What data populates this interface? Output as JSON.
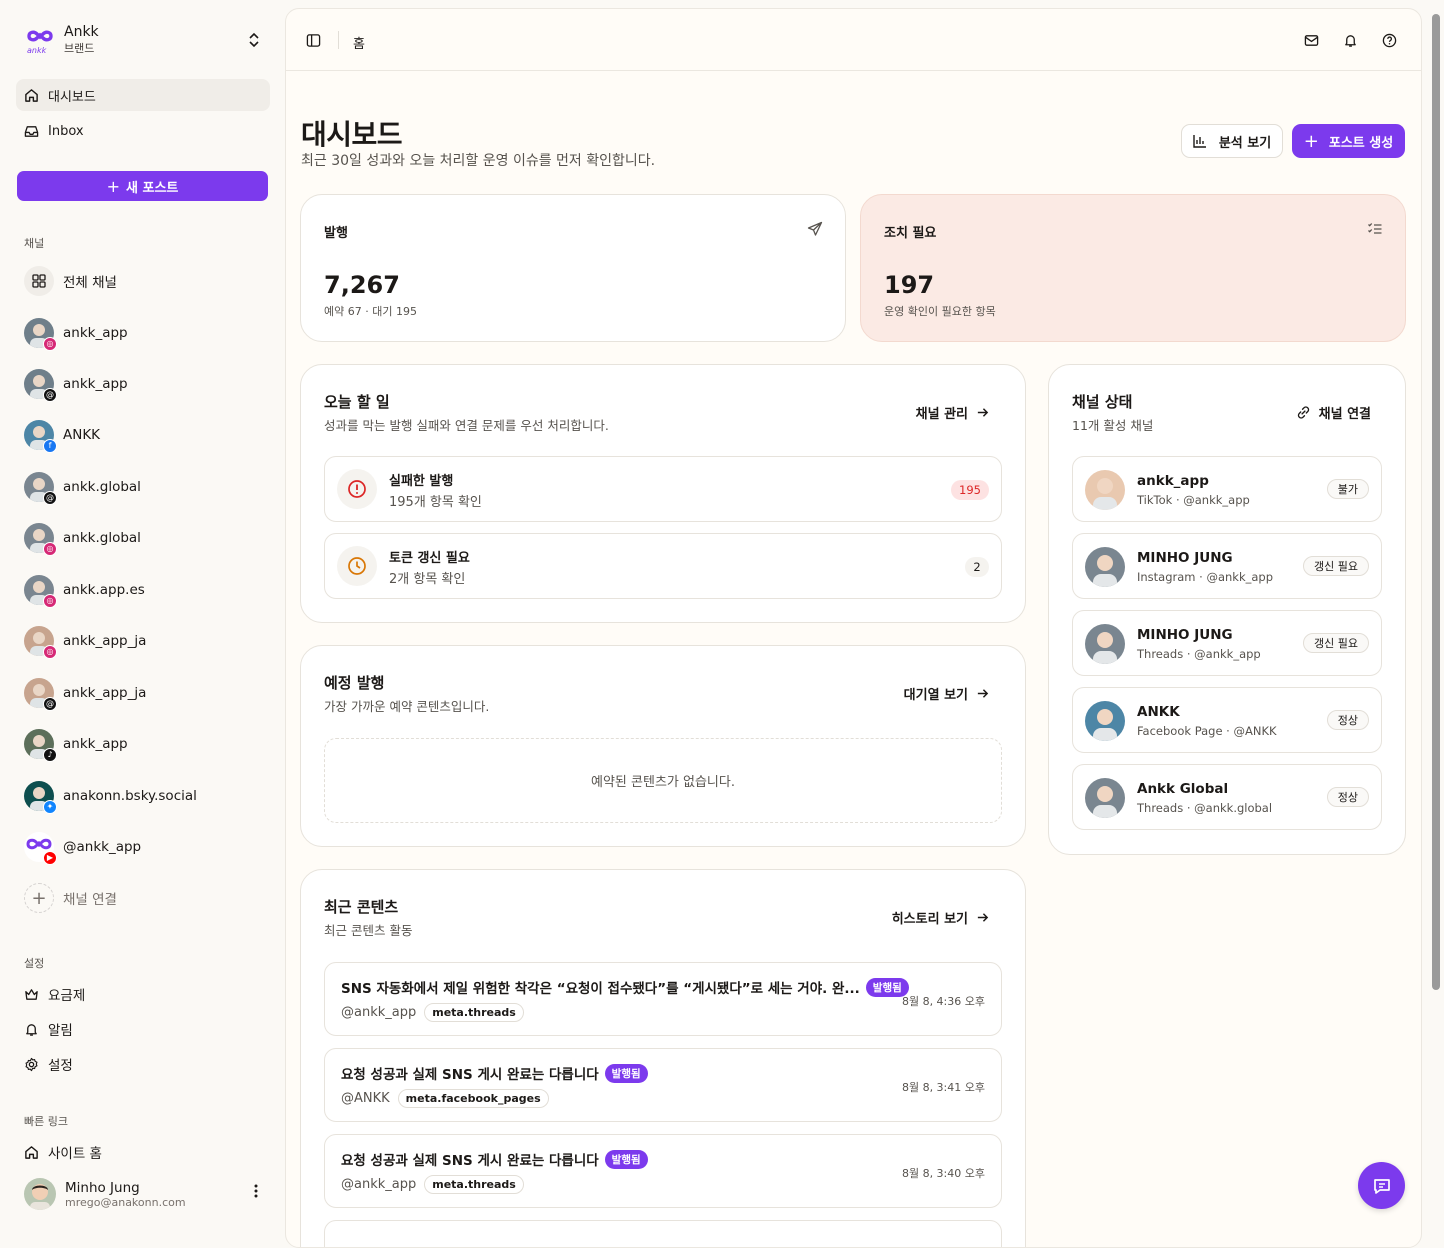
{
  "brand": {
    "name": "Ankk",
    "sub": "브랜드",
    "logo_text": "ankk"
  },
  "nav": {
    "dashboard": "대시보드",
    "inbox": "Inbox"
  },
  "new_post_label": "새 포스트",
  "channels_label": "채널",
  "all_channels": "전체 채널",
  "channels": [
    {
      "name": "ankk_app",
      "platform": "instagram",
      "badge_color": "#d62976"
    },
    {
      "name": "ankk_app",
      "platform": "threads",
      "badge_color": "#111111"
    },
    {
      "name": "ANKK",
      "platform": "facebook",
      "badge_color": "#1877f2"
    },
    {
      "name": "ankk.global",
      "platform": "threads",
      "badge_color": "#111111"
    },
    {
      "name": "ankk.global",
      "platform": "instagram",
      "badge_color": "#d62976"
    },
    {
      "name": "ankk.app.es",
      "platform": "instagram",
      "badge_color": "#d62976"
    },
    {
      "name": "ankk_app_ja",
      "platform": "instagram",
      "badge_color": "#d62976"
    },
    {
      "name": "ankk_app_ja",
      "platform": "threads",
      "badge_color": "#111111"
    },
    {
      "name": "ankk_app",
      "platform": "tiktok",
      "badge_color": "#111111"
    },
    {
      "name": "anakonn.bsky.social",
      "platform": "bluesky",
      "badge_color": "#1185fe"
    },
    {
      "name": "@ankk_app",
      "platform": "youtube",
      "badge_color": "#ff0000"
    }
  ],
  "connect_channel": "채널 연결",
  "settings_label": "설정",
  "settings_items": {
    "pricing": "요금제",
    "alerts": "알림",
    "settings": "설정"
  },
  "quick_links_label": "빠른 링크",
  "site_home": "사이트 홈",
  "user": {
    "name": "Minho Jung",
    "email": "mrego@anakonn.com"
  },
  "breadcrumb": "홈",
  "page": {
    "title": "대시보드",
    "subtitle": "최근 30일 성과와 오늘 처리할 운영 이슈를 먼저 확인합니다."
  },
  "buttons": {
    "analytics": "분석 보기",
    "create_post": "포스트 생성"
  },
  "stats": {
    "published": {
      "label": "발행",
      "value": "7,267",
      "sub": "예약 67 · 대기 195"
    },
    "action": {
      "label": "조치 필요",
      "value": "197",
      "sub": "운영 확인이 필요한 항목"
    }
  },
  "today": {
    "title": "오늘 할 일",
    "subtitle": "성과를 막는 발행 실패와 연결 문제를 우선 처리합니다.",
    "link": "채널 관리",
    "tasks": [
      {
        "title": "실패한 발행",
        "sub": "195개 항목 확인",
        "count": "195"
      },
      {
        "title": "토큰 갱신 필요",
        "sub": "2개 항목 확인",
        "count": "2"
      }
    ]
  },
  "scheduled": {
    "title": "예정 발행",
    "subtitle": "가장 가까운 예약 콘텐츠입니다.",
    "link": "대기열 보기",
    "empty": "예약된 콘텐츠가 없습니다."
  },
  "recent": {
    "title": "최근 콘텐츠",
    "subtitle": "최근 콘텐츠 활동",
    "link": "히스토리 보기",
    "items": [
      {
        "title": "SNS 자동화에서 제일 위험한 착각은 “요청이 접수됐다”를 “게시됐다”로 세는 거야. 완...",
        "badge": "발행됨",
        "account": "@ankk_app",
        "tag": "meta.threads",
        "time": "8월 8, 4:36 오후"
      },
      {
        "title": "요청 성공과 실제 SNS 게시 완료는 다릅니다",
        "badge": "발행됨",
        "account": "@ANKK",
        "tag": "meta.facebook_pages",
        "time": "8월 8, 3:41 오후"
      },
      {
        "title": "요청 성공과 실제 SNS 게시 완료는 다릅니다",
        "badge": "발행됨",
        "account": "@ankk_app",
        "tag": "meta.threads",
        "time": "8월 8, 3:40 오후"
      }
    ]
  },
  "channel_status": {
    "title": "채널 상태",
    "subtitle": "11개 활성 채널",
    "link": "채널 연결",
    "items": [
      {
        "name": "ankk_app",
        "sub": "TikTok · @ankk_app",
        "status": "불가"
      },
      {
        "name": "MINHO JUNG",
        "sub": "Instagram · @ankk_app",
        "status": "갱신 필요"
      },
      {
        "name": "MINHO JUNG",
        "sub": "Threads · @ankk_app",
        "status": "갱신 필요"
      },
      {
        "name": "ANKK",
        "sub": "Facebook Page · @ANKK",
        "status": "정상"
      },
      {
        "name": "Ankk Global",
        "sub": "Threads · @ankk.global",
        "status": "정상"
      }
    ]
  },
  "colors": {
    "accent": "#7c3aed",
    "danger": "#dc2626",
    "warning": "#d97706",
    "action_card_bg": "#fbeae4"
  }
}
